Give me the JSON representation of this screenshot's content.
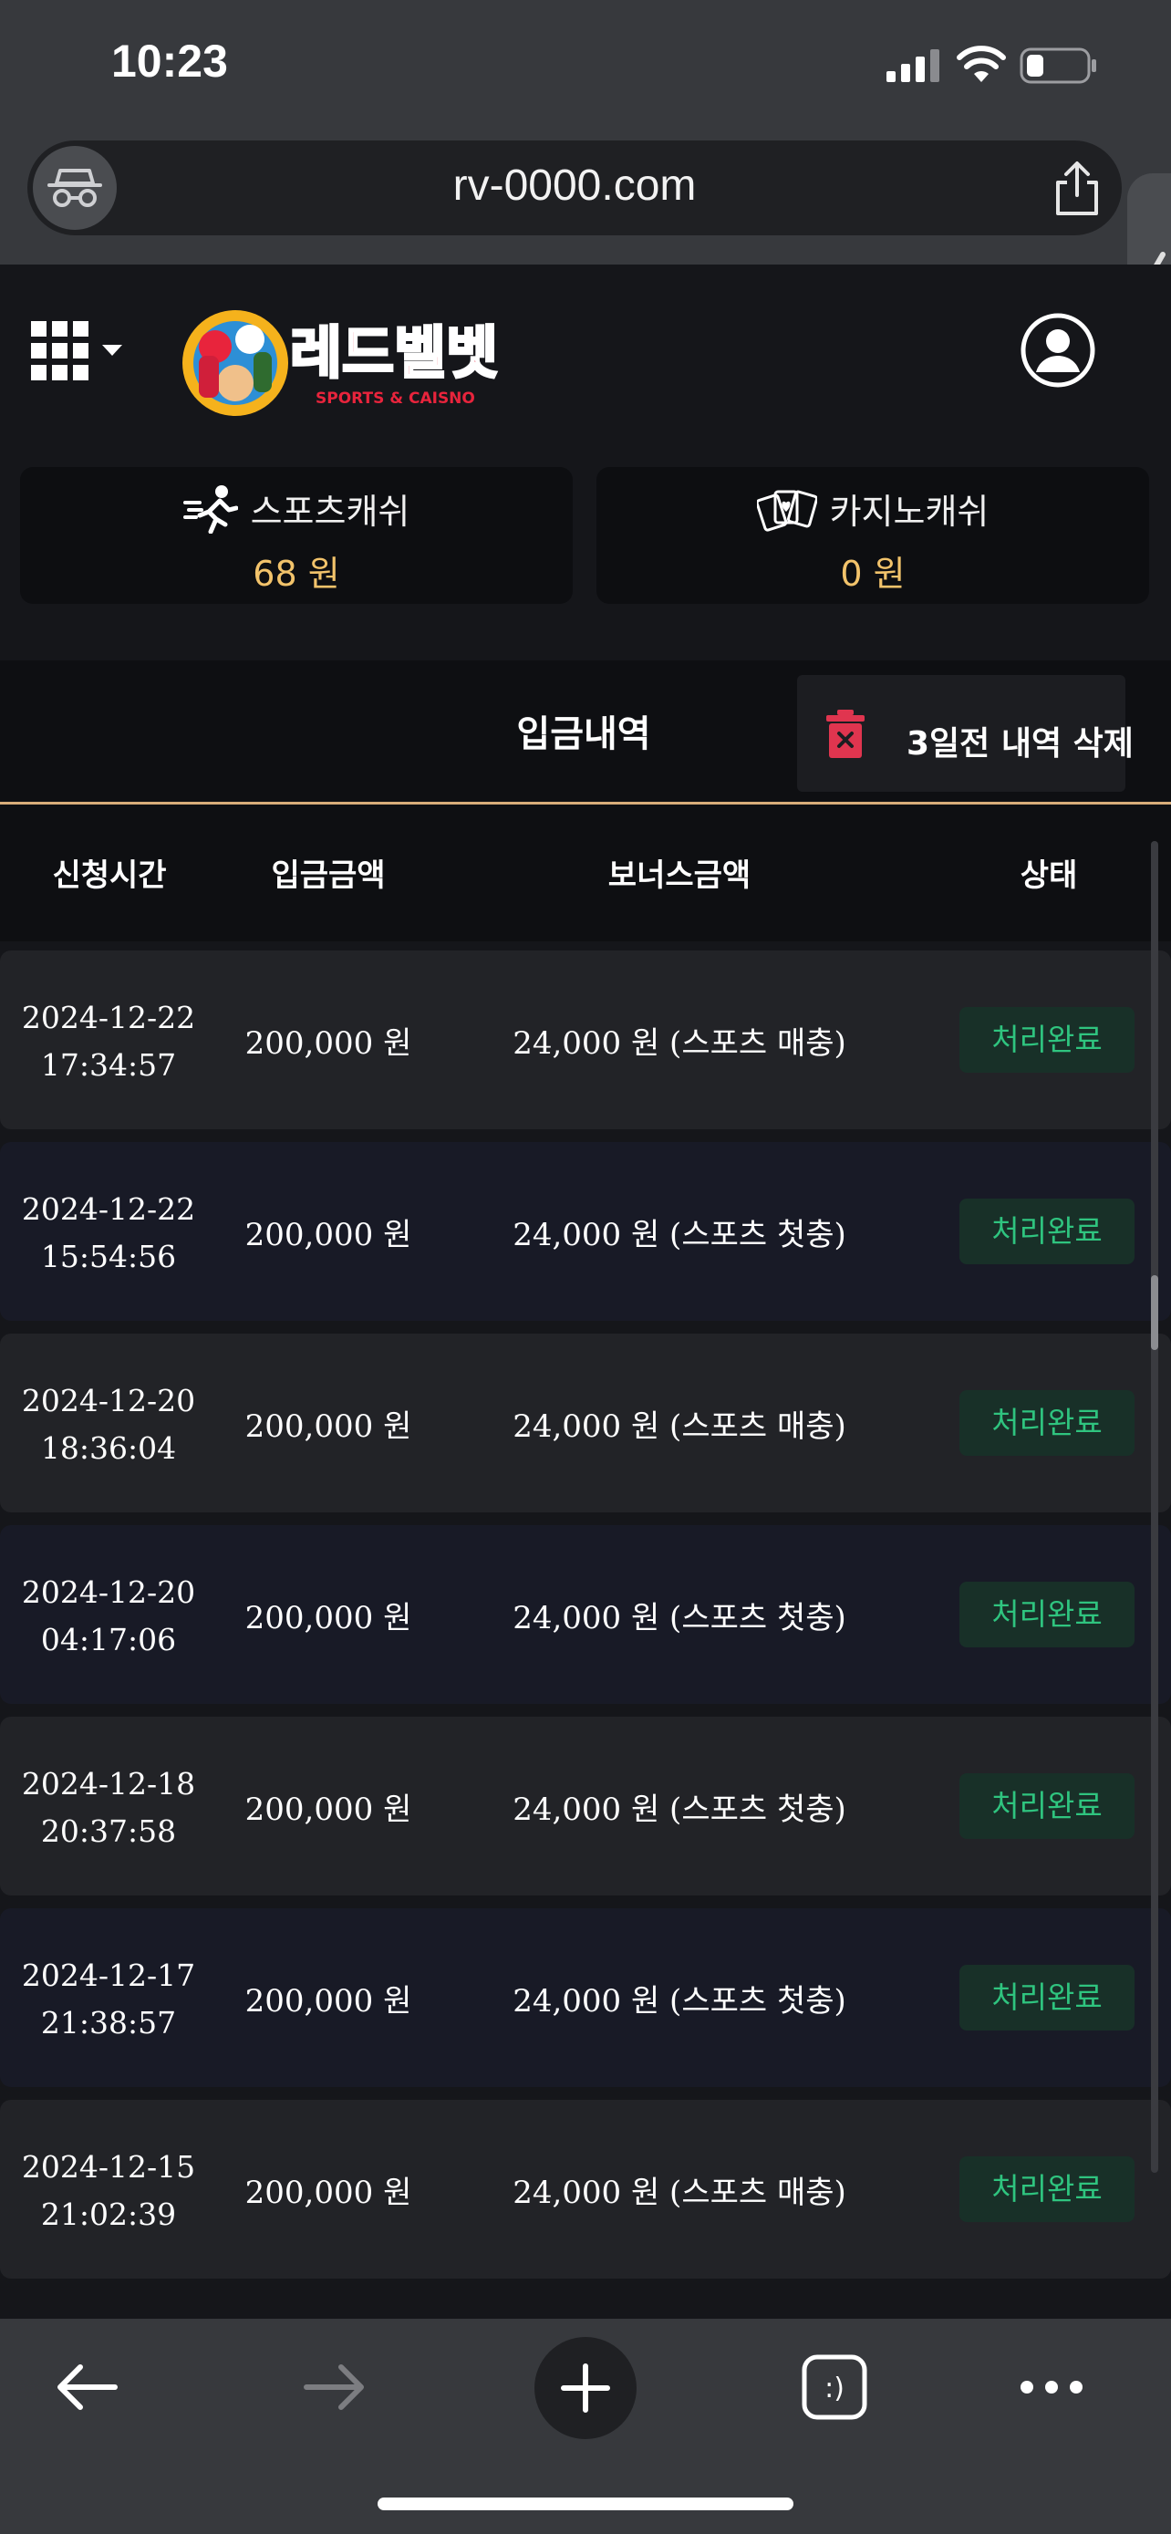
{
  "status_bar": {
    "time": "10:23"
  },
  "browser": {
    "url": "rv-0000.com"
  },
  "logo": {
    "name": "레드벨벳",
    "tagline": "SPORTS & CAISNO"
  },
  "wallet": {
    "sports": {
      "label": "스포츠캐쉬",
      "value": "68 원"
    },
    "casino": {
      "label": "카지노캐쉬",
      "value": "0 원"
    }
  },
  "history": {
    "title": "입금내역",
    "delete_label": "3일전 내역 삭제",
    "columns": {
      "time": "신청시간",
      "amount": "입금금액",
      "bonus": "보너스금액",
      "status": "상태"
    },
    "rows": [
      {
        "date": "2024-12-22",
        "time": "17:34:57",
        "amount": "200,000 원",
        "bonus": "24,000 원 (스포츠 매충)",
        "status": "처리완료"
      },
      {
        "date": "2024-12-22",
        "time": "15:54:56",
        "amount": "200,000 원",
        "bonus": "24,000 원 (스포츠 첫충)",
        "status": "처리완료"
      },
      {
        "date": "2024-12-20",
        "time": "18:36:04",
        "amount": "200,000 원",
        "bonus": "24,000 원 (스포츠 매충)",
        "status": "처리완료"
      },
      {
        "date": "2024-12-20",
        "time": "04:17:06",
        "amount": "200,000 원",
        "bonus": "24,000 원 (스포츠 첫충)",
        "status": "처리완료"
      },
      {
        "date": "2024-12-18",
        "time": "20:37:58",
        "amount": "200,000 원",
        "bonus": "24,000 원 (스포츠 첫충)",
        "status": "처리완료"
      },
      {
        "date": "2024-12-17",
        "time": "21:38:57",
        "amount": "200,000 원",
        "bonus": "24,000 원 (스포츠 첫충)",
        "status": "처리완료"
      },
      {
        "date": "2024-12-15",
        "time": "21:02:39",
        "amount": "200,000 원",
        "bonus": "24,000 원 (스포츠 매충)",
        "status": "처리완료"
      }
    ]
  },
  "toolbar": {
    "tabs_label": ":)"
  },
  "colors": {
    "accent_gold": "#f2c36b",
    "status_green": "#2fc47f",
    "divider": "#d8ad7a",
    "brand_red": "#e8243c"
  }
}
